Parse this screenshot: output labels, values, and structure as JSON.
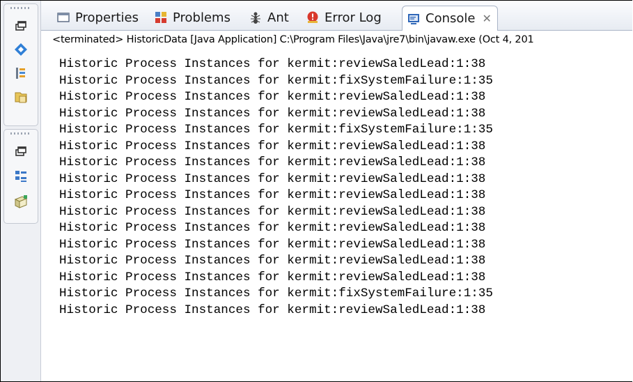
{
  "tabs": [
    {
      "label": "Properties",
      "icon": "properties-icon"
    },
    {
      "label": "Problems",
      "icon": "problems-icon"
    },
    {
      "label": "Ant",
      "icon": "ant-icon"
    },
    {
      "label": "Error Log",
      "icon": "error-log-icon"
    },
    {
      "label": "Console",
      "icon": "console-icon",
      "active": true,
      "close": "✕"
    }
  ],
  "status": "<terminated> HistoricData [Java Application] C:\\Program Files\\Java\\jre7\\bin\\javaw.exe (Oct 4, 201",
  "console_lines": [
    "Historic Process Instances for kermit:reviewSaledLead:1:38",
    "Historic Process Instances for kermit:fixSystemFailure:1:35",
    "Historic Process Instances for kermit:reviewSaledLead:1:38",
    "Historic Process Instances for kermit:reviewSaledLead:1:38",
    "Historic Process Instances for kermit:fixSystemFailure:1:35",
    "Historic Process Instances for kermit:reviewSaledLead:1:38",
    "Historic Process Instances for kermit:reviewSaledLead:1:38",
    "Historic Process Instances for kermit:reviewSaledLead:1:38",
    "Historic Process Instances for kermit:reviewSaledLead:1:38",
    "Historic Process Instances for kermit:reviewSaledLead:1:38",
    "Historic Process Instances for kermit:reviewSaledLead:1:38",
    "Historic Process Instances for kermit:reviewSaledLead:1:38",
    "Historic Process Instances for kermit:reviewSaledLead:1:38",
    "Historic Process Instances for kermit:reviewSaledLead:1:38",
    "Historic Process Instances for kermit:fixSystemFailure:1:35",
    "Historic Process Instances for kermit:reviewSaledLead:1:38"
  ],
  "left_rail_icons": [
    "restore-icon",
    "java-element-icon",
    "hierarchy-icon",
    "package-explorer-icon",
    "restore-icon",
    "outline-icon",
    "server-icon"
  ],
  "colors": {
    "tab_border": "#a9b4c7",
    "rail_bg": "#eef0f4",
    "console_text": "#000000"
  }
}
